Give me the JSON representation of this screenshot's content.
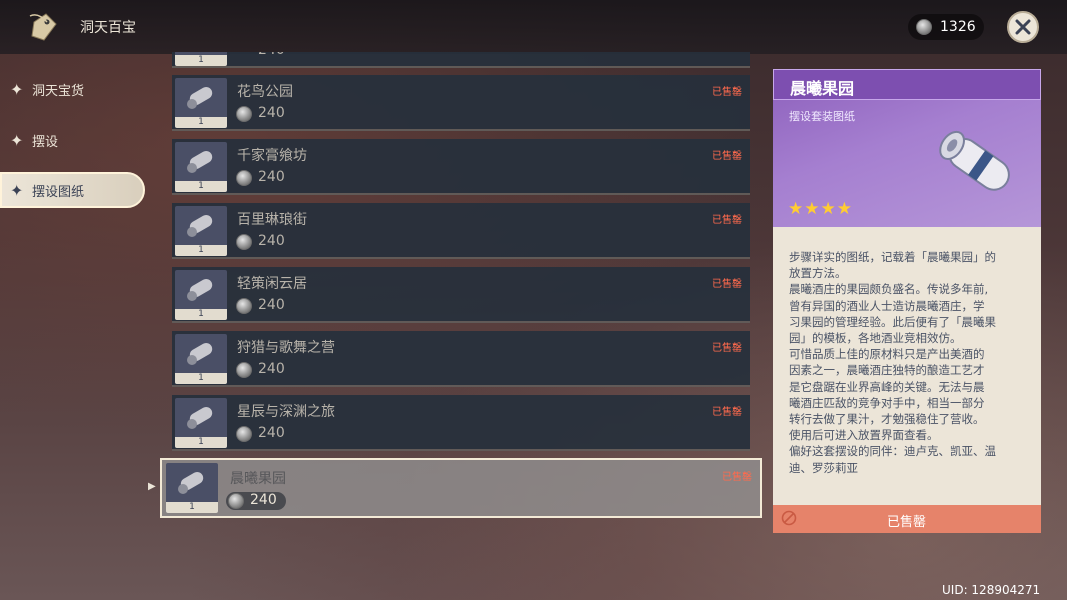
{
  "header": {
    "title": "洞天百宝",
    "currency_value": "1326"
  },
  "sidebar": {
    "items": [
      {
        "label": "洞天宝货"
      },
      {
        "label": "摆设"
      },
      {
        "label": "摆设图纸"
      }
    ]
  },
  "list": {
    "partial_row_price": "240",
    "partial_row_count": "1",
    "items": [
      {
        "name": "花鸟公园",
        "price": "240",
        "count": "1",
        "status": "已售罄"
      },
      {
        "name": "千家膏飨坊",
        "price": "240",
        "count": "1",
        "status": "已售罄"
      },
      {
        "name": "百里琳琅街",
        "price": "240",
        "count": "1",
        "status": "已售罄"
      },
      {
        "name": "轻策闲云居",
        "price": "240",
        "count": "1",
        "status": "已售罄"
      },
      {
        "name": "狩猎与歌舞之营",
        "price": "240",
        "count": "1",
        "status": "已售罄"
      },
      {
        "name": "星辰与深渊之旅",
        "price": "240",
        "count": "1",
        "status": "已售罄"
      },
      {
        "name": "晨曦果园",
        "price": "240",
        "count": "1",
        "status": "已售罄"
      }
    ]
  },
  "detail": {
    "title": "晨曦果园",
    "type": "摆设套装图纸",
    "rarity": 4,
    "stars": "★★★★",
    "description": [
      "步骤详实的图纸，记载着「晨曦果园」的",
      "放置方法。",
      "晨曦酒庄的果园颇负盛名。传说多年前,",
      "曾有异国的酒业人士造访晨曦酒庄，学",
      "习果园的管理经验。此后便有了「晨曦果",
      "园」的模板，各地酒业竞相效仿。",
      "可惜品质上佳的原材料只是产出美酒的",
      "因素之一，晨曦酒庄独特的酿造工艺才",
      "是它盘踞在业界高峰的关键。无法与晨",
      "曦酒庄匹敌的竞争对手中，相当一部分",
      "转行去做了果汁，才勉强稳住了营收。",
      "使用后可进入放置界面查看。",
      "偏好这套摆设的同伴：迪卢克、凯亚、温",
      "迪、罗莎莉亚"
    ],
    "buy_label": "已售罄"
  },
  "footer": {
    "uid": "UID: 128904271"
  },
  "colors": {
    "sold_out": "#ff6a4d",
    "purple_header": "#7d4fb0",
    "star": "#ffcc32",
    "buy_button": "#e6836a"
  }
}
